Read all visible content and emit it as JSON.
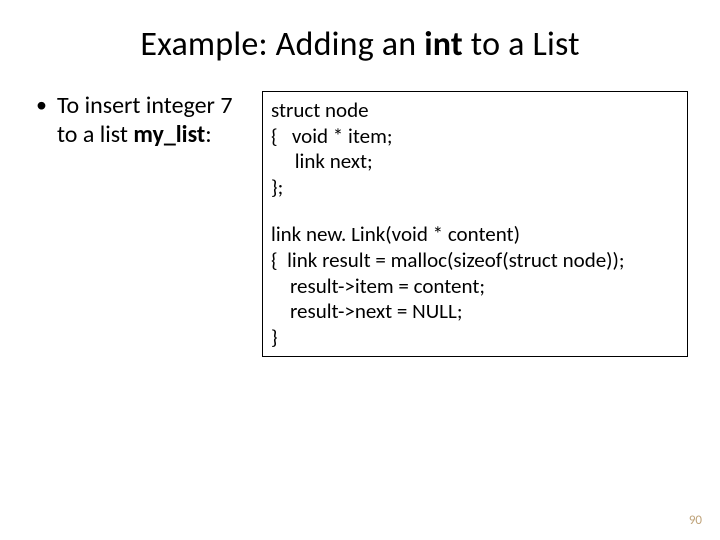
{
  "title": {
    "pre": "Example: Adding an ",
    "bold": "int",
    "post": " to a List"
  },
  "bullet": {
    "line1": "To insert integer 7",
    "line2_pre": "to a list ",
    "line2_bold": "my_list",
    "line2_post": ":"
  },
  "code": {
    "l1": "struct node",
    "l2": "{   void * item;",
    "l3": "     link next;",
    "l4": "};",
    "l5": "link new. Link(void * content)",
    "l6": "{  link result = malloc(sizeof(struct node));",
    "l7": "    result->item = content;",
    "l8": "    result->next = NULL;",
    "l9": "}"
  },
  "page_number": "90"
}
